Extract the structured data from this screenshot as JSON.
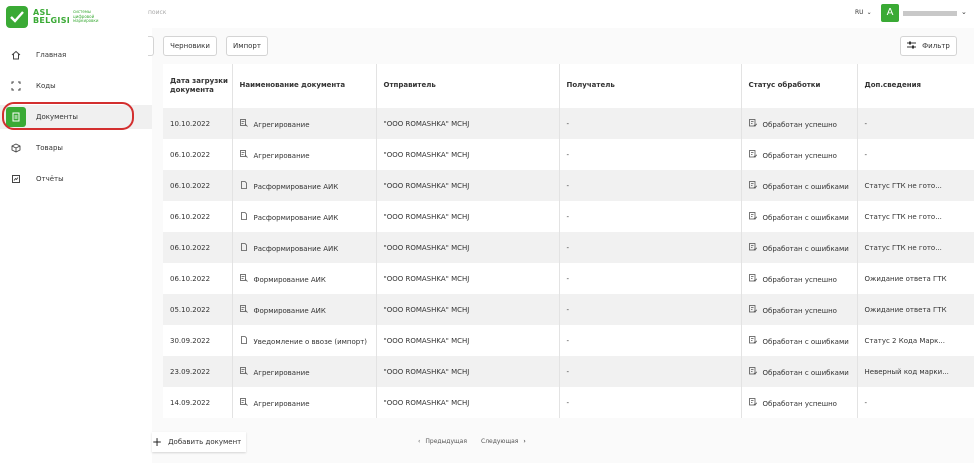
{
  "header": {
    "logo_line1": "ASL",
    "logo_line2": "BELGISI",
    "logo_tagline": "системы цифровой маркировки",
    "breadcrumb": "поиск",
    "language": "RU",
    "avatar_letter": "А"
  },
  "sidebar": {
    "items": [
      {
        "label": "Главная",
        "icon": "home-icon"
      },
      {
        "label": "Коды",
        "icon": "scan-icon"
      },
      {
        "label": "Документы",
        "icon": "document-icon"
      },
      {
        "label": "Товары",
        "icon": "box-icon"
      },
      {
        "label": "Отчёты",
        "icon": "report-icon"
      }
    ],
    "active_index": 2
  },
  "toolbar": {
    "drafts_label": "Черновики",
    "import_label": "Импорт",
    "filter_label": "Фильтр"
  },
  "table": {
    "columns": [
      "Дата загрузки документа",
      "Наименование документа",
      "Отправитель",
      "Получатель",
      "Статус обработки",
      "Доп.сведения"
    ],
    "rows": [
      {
        "date": "10.10.2022",
        "name": "Агрегирование",
        "name_icon": "aggregation-icon",
        "sender": "\"ООО ROMASHKA\" MCHJ",
        "receiver": "-",
        "status": "Обработан успешно",
        "info": "-"
      },
      {
        "date": "06.10.2022",
        "name": "Агрегирование",
        "name_icon": "aggregation-icon",
        "sender": "\"ООО ROMASHKA\" MCHJ",
        "receiver": "-",
        "status": "Обработан успешно",
        "info": "-"
      },
      {
        "date": "06.10.2022",
        "name": "Расформирование АИК",
        "name_icon": "file-icon",
        "sender": "\"ООО ROMASHKA\" MCHJ",
        "receiver": "-",
        "status": "Обработан с ошибками",
        "info": "Статус ГТК не гото..."
      },
      {
        "date": "06.10.2022",
        "name": "Расформирование АИК",
        "name_icon": "file-icon",
        "sender": "\"ООО ROMASHKA\" MCHJ",
        "receiver": "-",
        "status": "Обработан с ошибками",
        "info": "Статус ГТК не гото..."
      },
      {
        "date": "06.10.2022",
        "name": "Расформирование АИК",
        "name_icon": "file-icon",
        "sender": "\"ООО ROMASHKA\" MCHJ",
        "receiver": "-",
        "status": "Обработан с ошибками",
        "info": "Статус ГТК не гото..."
      },
      {
        "date": "06.10.2022",
        "name": "Формирование АИК",
        "name_icon": "aggregation-icon",
        "sender": "\"ООО ROMASHKA\" MCHJ",
        "receiver": "-",
        "status": "Обработан успешно",
        "info": "Ожидание ответа ГТК"
      },
      {
        "date": "05.10.2022",
        "name": "Формирование АИК",
        "name_icon": "aggregation-icon",
        "sender": "\"ООО ROMASHKA\" MCHJ",
        "receiver": "-",
        "status": "Обработан успешно",
        "info": "Ожидание ответа ГТК"
      },
      {
        "date": "30.09.2022",
        "name": "Уведомление о ввозе (импорт)",
        "name_icon": "file-icon",
        "sender": "\"ООО ROMASHKA\" MCHJ",
        "receiver": "-",
        "status": "Обработан с ошибками",
        "info": "Статус 2 Кода Марк..."
      },
      {
        "date": "23.09.2022",
        "name": "Агрегирование",
        "name_icon": "aggregation-icon",
        "sender": "\"ООО ROMASHKA\" MCHJ",
        "receiver": "-",
        "status": "Обработан с ошибками",
        "info": "Неверный код марки..."
      },
      {
        "date": "14.09.2022",
        "name": "Агрегирование",
        "name_icon": "aggregation-icon",
        "sender": "\"ООО ROMASHKA\" MCHJ",
        "receiver": "-",
        "status": "Обработан успешно",
        "info": "-"
      }
    ]
  },
  "footer": {
    "add_label": "Добавить документ",
    "prev_label": "Предыдущая",
    "next_label": "Следующая"
  },
  "colors": {
    "brand": "#3aaa35",
    "highlight": "#d32f2f"
  }
}
